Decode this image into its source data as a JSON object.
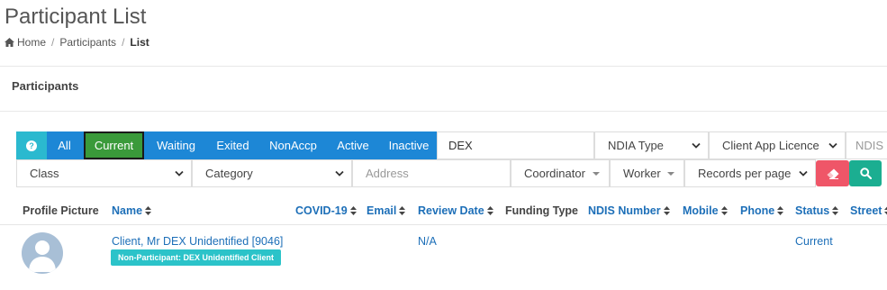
{
  "page": {
    "title": "Participant List",
    "breadcrumb": [
      "Home",
      "Participants",
      "List"
    ],
    "section_title": "Participants"
  },
  "filters": {
    "help_symbol": "?",
    "status_buttons": [
      "All",
      "Current",
      "Waiting",
      "Exited",
      "NonAccp",
      "Active",
      "Inactive"
    ],
    "active_status": "Current",
    "search_value": "DEX",
    "ndia_type": "NDIA Type",
    "client_app_licence": "Client App Licence",
    "ndis_partial": "NDIS I",
    "class": "Class",
    "category": "Category",
    "address_placeholder": "Address",
    "coordinator": "Coordinator",
    "worker": "Worker",
    "records_per_page": "Records per page"
  },
  "table": {
    "headers": [
      "Profile Picture",
      "Name",
      "COVID-19",
      "Email",
      "Review Date",
      "Funding Type",
      "NDIS Number",
      "Mobile",
      "Phone",
      "Status",
      "Street"
    ],
    "rows": [
      {
        "name": "Client, Mr DEX Unidentified [9046]",
        "badge": "Non-Participant: DEX Unidentified Client",
        "review_date": "N/A",
        "status": "Current"
      }
    ]
  },
  "colors": {
    "primary": "#1d87d6",
    "active_green": "#3a9a3a",
    "info": "#2bb9cf",
    "danger": "#ef5668",
    "success": "#1bae91",
    "badge": "#2bc3c9",
    "link": "#1d6fb8"
  }
}
